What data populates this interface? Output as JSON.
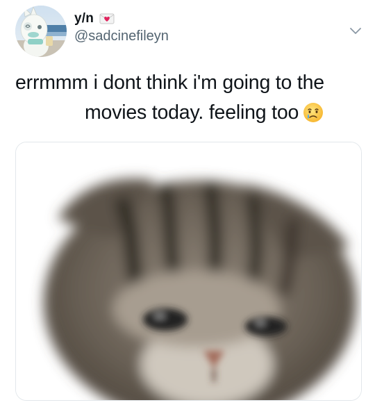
{
  "user": {
    "display_name": "y/n",
    "handle": "@sadcinefileyn",
    "badge_icon": "heart-letter-icon",
    "avatar_icon": "cartoon-avatar-icon"
  },
  "tweet": {
    "text_line1": "errmmm i dont think i'm going to the",
    "text_line2": "movies today. feeling too",
    "emoji_icon": "crying-face-emoji"
  },
  "media": {
    "image_icon": "kitten-photo"
  },
  "colors": {
    "text": "#0f1419",
    "secondary": "#536471",
    "border": "#e2e7eb",
    "heart": "#e0245e"
  },
  "menu": {
    "icon": "chevron-down-icon"
  }
}
